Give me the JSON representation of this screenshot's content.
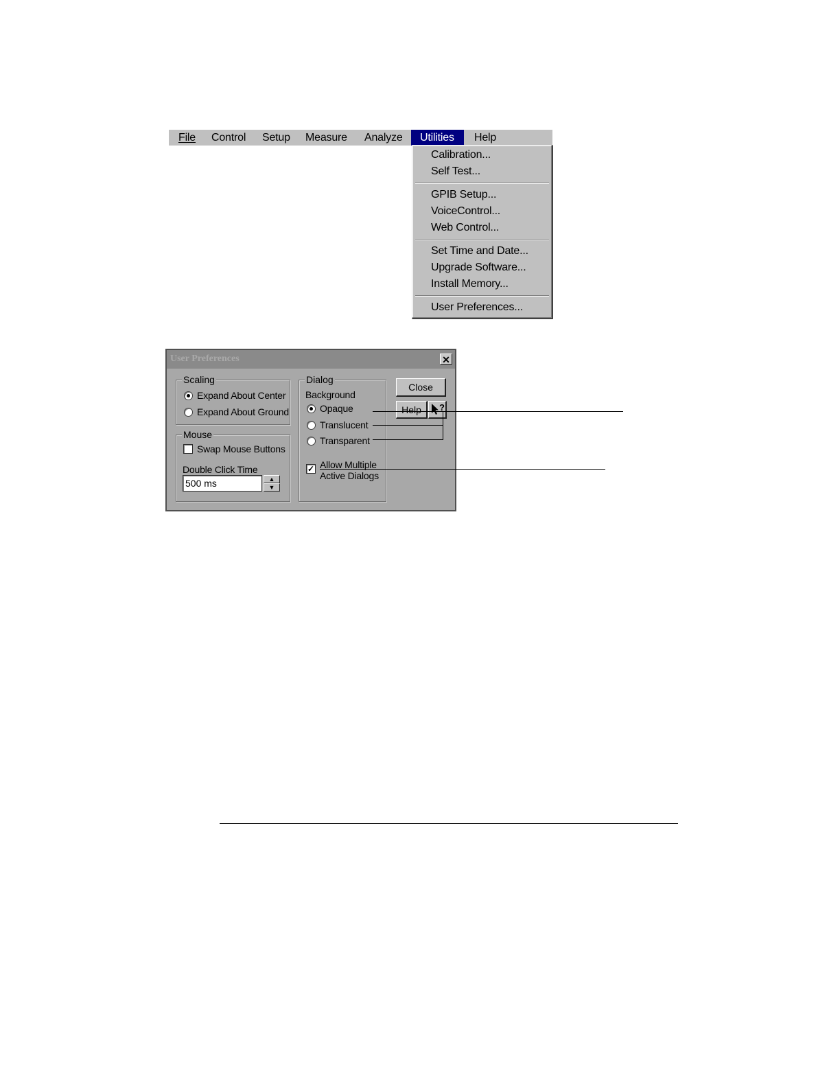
{
  "menubar": {
    "items": [
      {
        "label": "File"
      },
      {
        "label": "Control"
      },
      {
        "label": "Setup"
      },
      {
        "label": "Measure"
      },
      {
        "label": "Analyze"
      },
      {
        "label": "Utilities",
        "active": true
      },
      {
        "label": "Help"
      }
    ]
  },
  "utilities_menu": {
    "items": [
      {
        "label": "Calibration..."
      },
      {
        "label": "Self Test..."
      },
      {
        "label": "GPIB Setup..."
      },
      {
        "label": "VoiceControl..."
      },
      {
        "label": "Web Control..."
      },
      {
        "label": "Set Time and Date..."
      },
      {
        "label": "Upgrade Software..."
      },
      {
        "label": "Install Memory..."
      },
      {
        "label": "User Preferences..."
      }
    ]
  },
  "dialog": {
    "title": "User Preferences",
    "close_glyph": "✕",
    "scaling": {
      "label": "Scaling",
      "options": [
        {
          "label": "Expand About Center",
          "selected": true
        },
        {
          "label": "Expand About Ground",
          "selected": false
        }
      ]
    },
    "mouse": {
      "label": "Mouse",
      "swap_label": "Swap Mouse Buttons",
      "swap_checked": false,
      "double_click_label": "Double Click Time",
      "double_click_value": "500 ms"
    },
    "dialog_group": {
      "label": "Dialog",
      "background_label": "Background",
      "options": [
        {
          "label": "Opaque",
          "selected": true
        },
        {
          "label": "Translucent",
          "selected": false
        },
        {
          "label": "Transparent",
          "selected": false
        }
      ],
      "allow_multiple_line1": "Allow Multiple",
      "allow_multiple_line2": "Active Dialogs",
      "allow_multiple_checked": true
    },
    "buttons": {
      "close": "Close",
      "help": "Help",
      "context_help_glyph": "?"
    }
  },
  "colors": {
    "menu_highlight": "#000080",
    "window_face": "#c0c0c0",
    "dialog_face": "#a8a8a8"
  }
}
